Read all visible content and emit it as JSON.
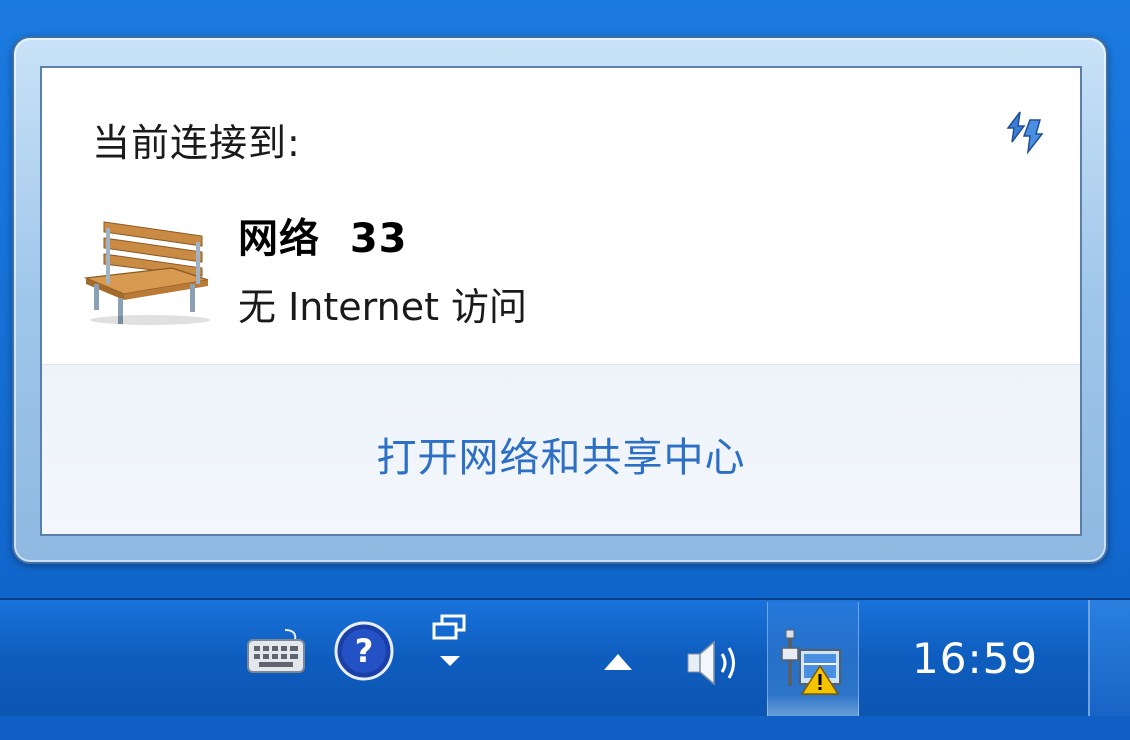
{
  "flyout": {
    "connected_label": "当前连接到:",
    "network_name": "网络  33",
    "network_status": "无 Internet 访问",
    "open_center_link": "打开网络和共享中心",
    "refresh_icon": "refresh-arrows-icon",
    "network_icon": "bench-icon"
  },
  "taskbar": {
    "clock": "16:59",
    "tray_icons": [
      "keyboard-icon",
      "help-icon",
      "restore-windows-icon",
      "show-hidden-icons-arrow",
      "volume-icon",
      "network-warning-icon"
    ]
  },
  "colors": {
    "taskbar_blue": "#1269cf",
    "link_blue": "#2c6fc4",
    "warning_yellow": "#f5c400"
  }
}
